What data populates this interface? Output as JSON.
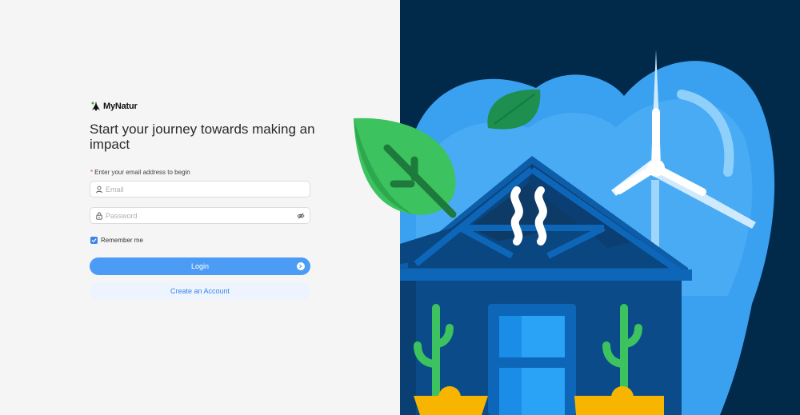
{
  "brand": {
    "name": "MyNatur"
  },
  "heading": "Start your journey towards making an impact",
  "form": {
    "prompt": "Enter your email address to begin",
    "email_placeholder": "Email",
    "password_placeholder": "Password",
    "remember_label": "Remember me",
    "remember_checked": true,
    "login_label": "Login",
    "create_label": "Create an Account"
  },
  "colors": {
    "accent": "#4c9cf5",
    "navy": "#00294a",
    "sky": "#3aa0f0",
    "leaf": "#3cc25e"
  }
}
